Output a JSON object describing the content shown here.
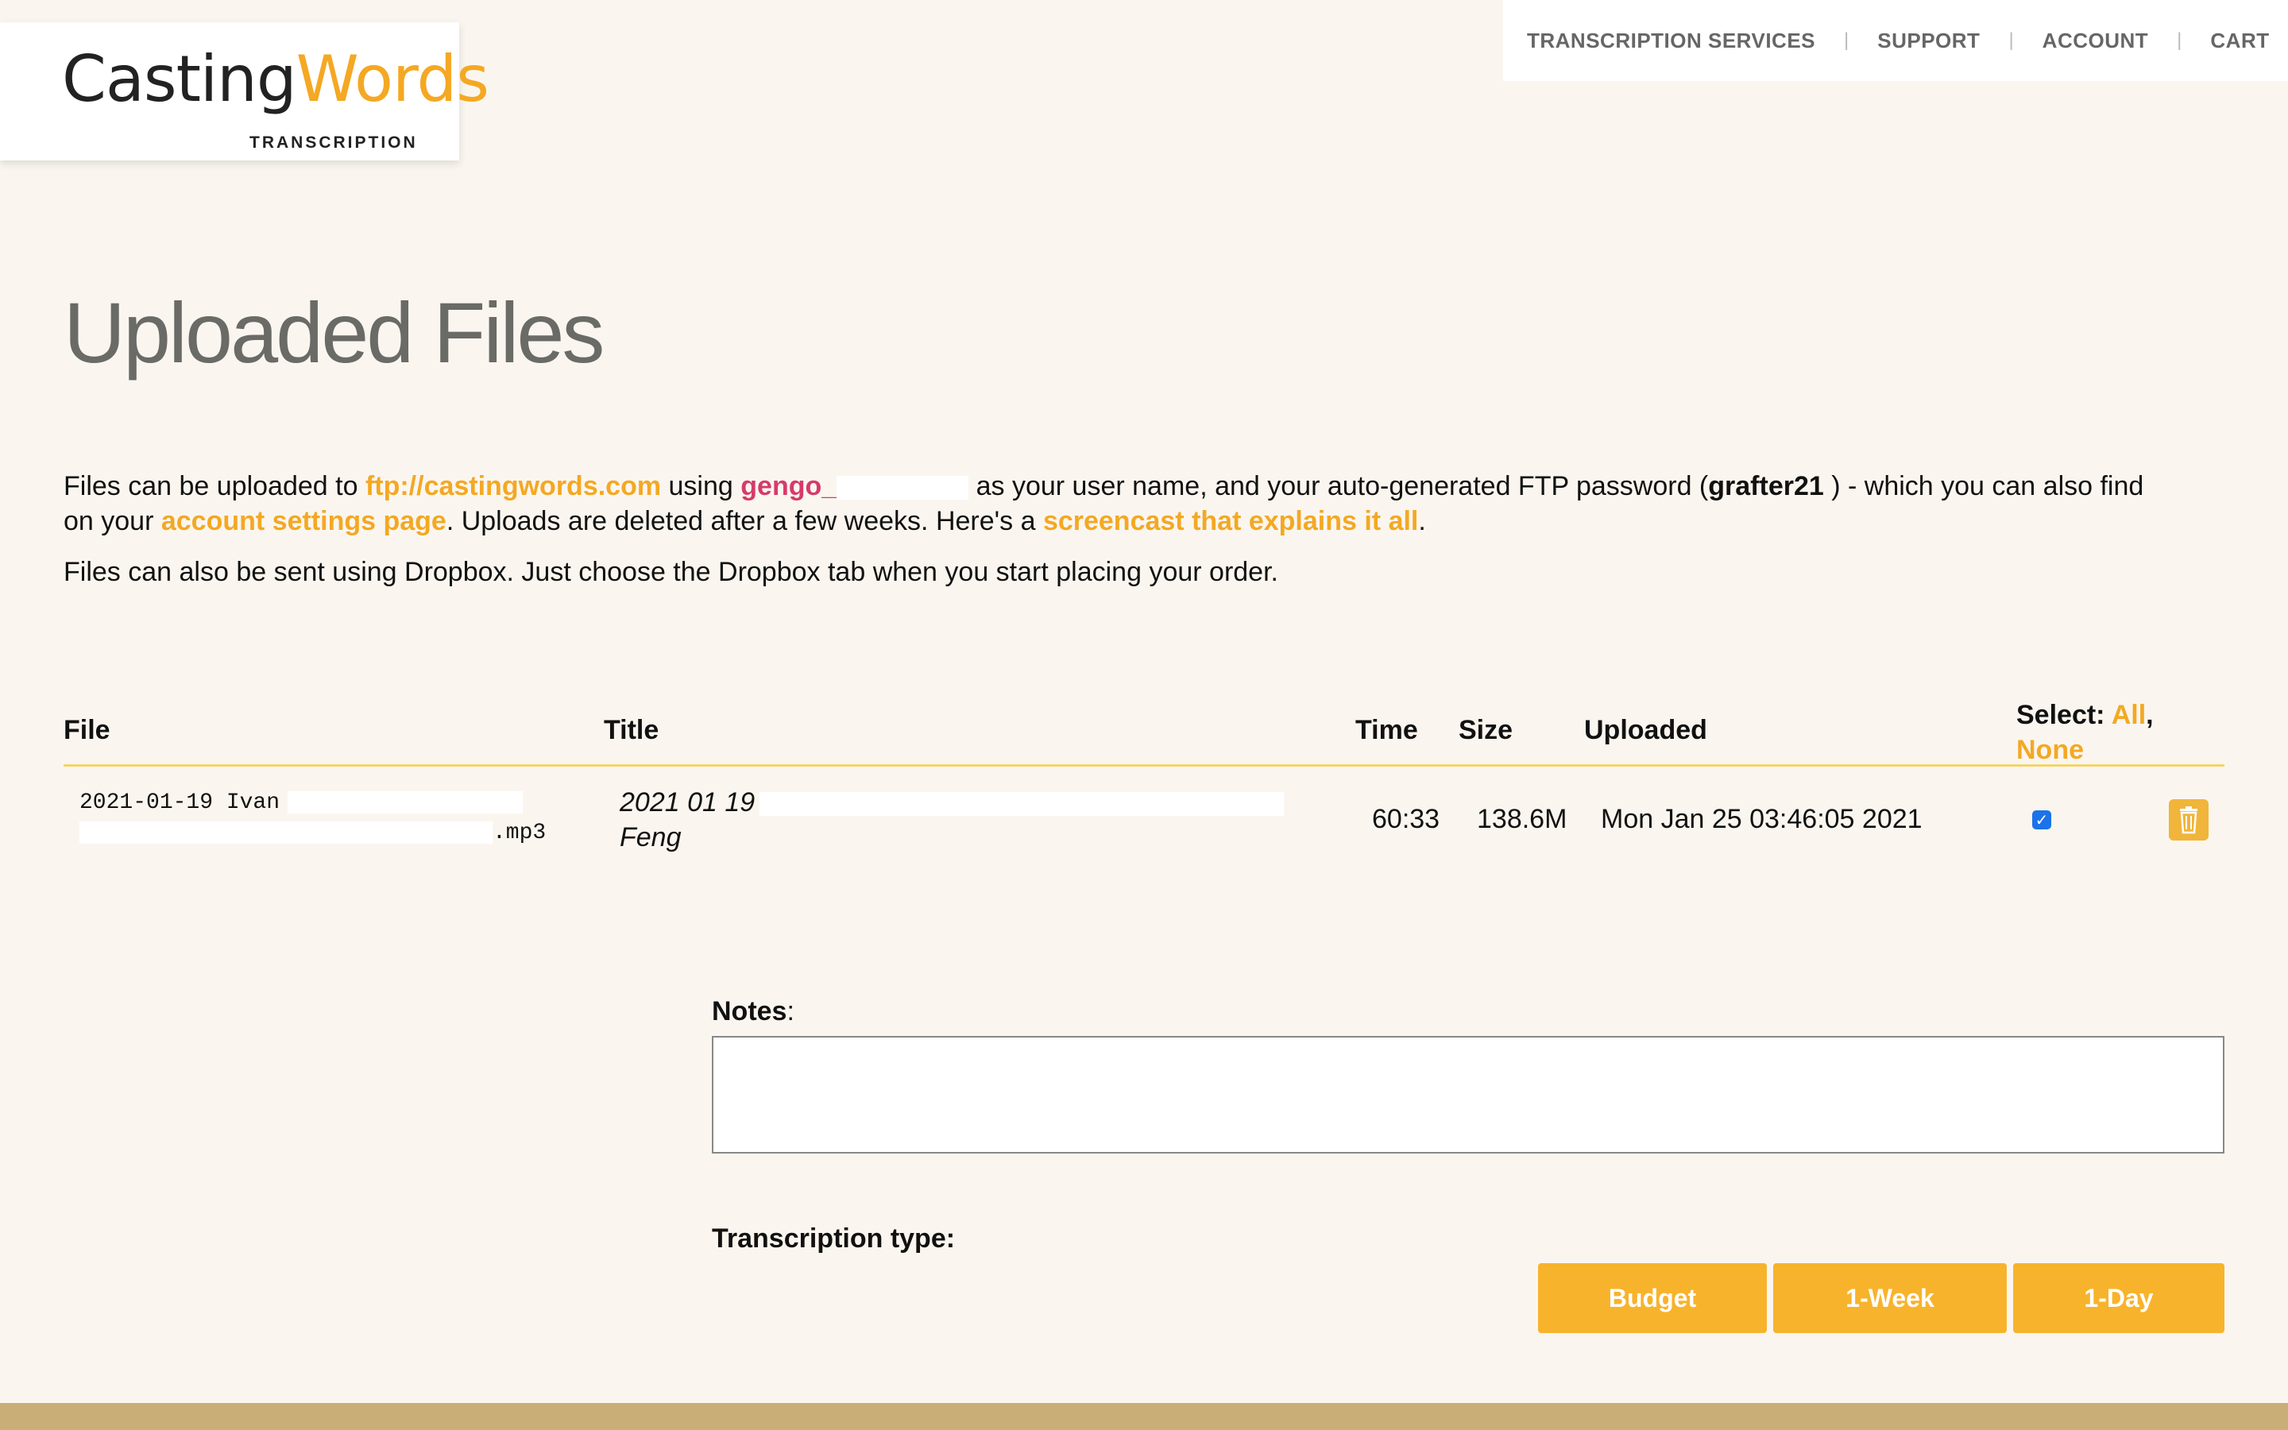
{
  "logo": {
    "word1": "Casting",
    "word2": "Words",
    "subtitle": "TRANSCRIPTION"
  },
  "nav": {
    "items": [
      {
        "label": "TRANSCRIPTION SERVICES"
      },
      {
        "label": "SUPPORT"
      },
      {
        "label": "ACCOUNT"
      },
      {
        "label": "CART"
      }
    ],
    "separator": "|"
  },
  "page": {
    "title": "Uploaded Files"
  },
  "intro": {
    "p1_a": "Files can be uploaded to ",
    "ftp_link": "ftp://castingwords.com",
    "p1_b": " using ",
    "username": "gengo_",
    "p1_c": " as your user name, and your auto-generated FTP password (",
    "password": "grafter21",
    "p1_d": " ) - which you can also find on your ",
    "settings_link": "account settings page",
    "p1_e": ". Uploads are deleted after a few weeks. Here's a ",
    "screencast_link": "screencast that explains it all",
    "p1_f": ".",
    "p2": "Files can also be sent using Dropbox. Just choose the Dropbox tab when you start placing your order."
  },
  "table": {
    "headers": {
      "file": "File",
      "title": "Title",
      "time": "Time",
      "size": "Size",
      "uploaded": "Uploaded",
      "select_prefix": "Select: ",
      "select_all": "All",
      "select_comma": ",",
      "select_none": "None"
    },
    "rows": [
      {
        "file_line1": "2021-01-19 Ivan",
        "file_line2": ".mp3",
        "title_line1": "2021 01 19",
        "title_line2": "Feng",
        "time": "60:33",
        "size": "138.6M",
        "uploaded": "Mon Jan 25 03:46:05 2021",
        "checked": "✓"
      }
    ]
  },
  "notes": {
    "label": "Notes",
    "colon": ":",
    "value": ""
  },
  "transcription": {
    "label": "Transcription type:",
    "buttons": [
      "Budget",
      "1-Week",
      "1-Day"
    ]
  },
  "colors": {
    "accent": "#f4a823",
    "button": "#f8b32c",
    "background": "#faf6ef",
    "footer": "#c9ae78"
  }
}
